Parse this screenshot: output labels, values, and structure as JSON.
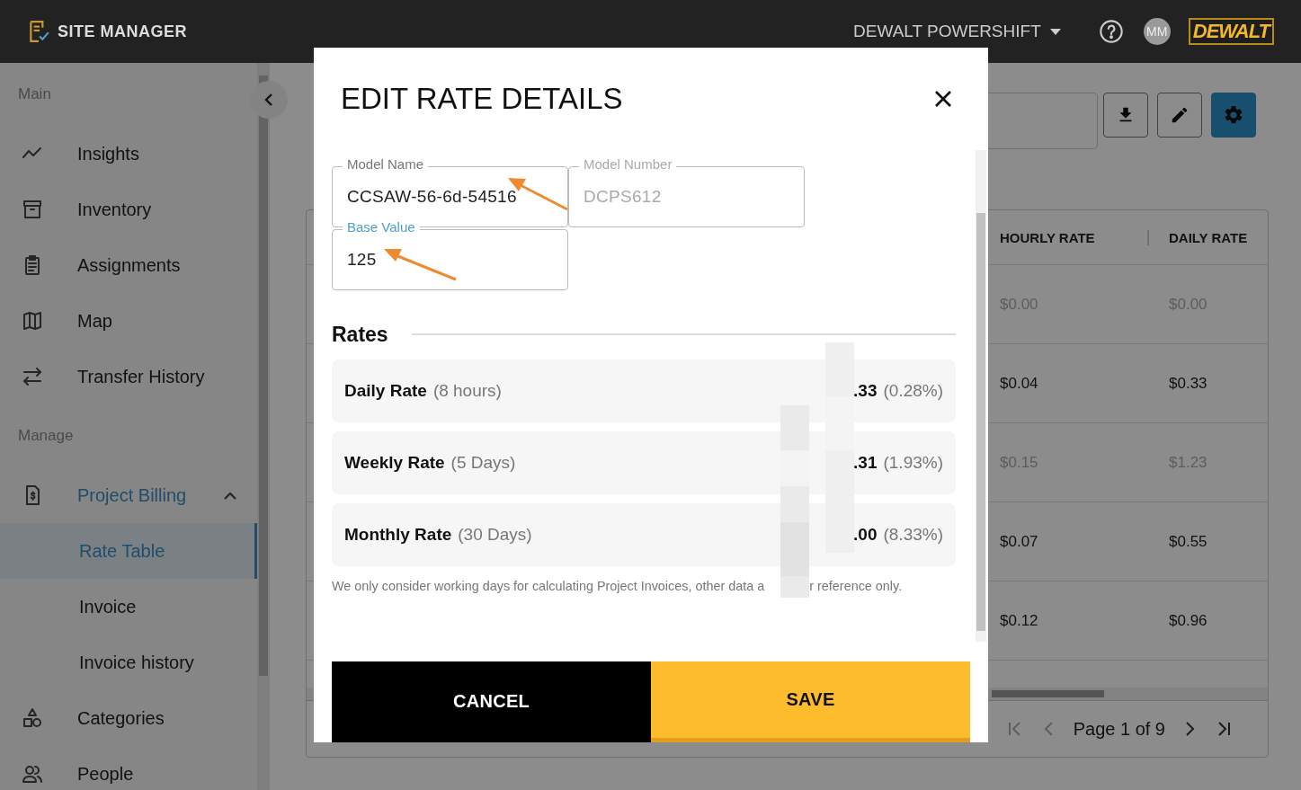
{
  "header": {
    "app_name": "SITE MANAGER",
    "account": "DEWALT POWERSHIFT",
    "avatar": "MM",
    "brand": "DEWALT"
  },
  "sidebar": {
    "sections": [
      {
        "title": "Main",
        "items": [
          {
            "label": "Insights",
            "selected": false
          },
          {
            "label": "Inventory",
            "selected": false
          },
          {
            "label": "Assignments",
            "selected": false
          },
          {
            "label": "Map",
            "selected": false
          },
          {
            "label": "Transfer History",
            "selected": false
          }
        ]
      },
      {
        "title": "Manage",
        "items": [
          {
            "label": "Project Billing",
            "selected": true,
            "expanded": true,
            "children": [
              {
                "label": "Rate Table",
                "selected": true
              },
              {
                "label": "Invoice",
                "selected": false
              },
              {
                "label": "Invoice history",
                "selected": false
              }
            ]
          },
          {
            "label": "Categories",
            "selected": false
          },
          {
            "label": "People",
            "selected": false
          }
        ]
      }
    ]
  },
  "toolbar": {
    "buttons": [
      {
        "kind": "download",
        "active": false
      },
      {
        "kind": "edit",
        "active": false
      },
      {
        "kind": "settings",
        "active": true
      }
    ]
  },
  "table": {
    "columns": [
      "HOURLY RATE",
      "DAILY RATE"
    ],
    "rows": [
      {
        "cells": [
          "$0.00",
          "$0.00"
        ],
        "disabled": true
      },
      {
        "cells": [
          "$0.04",
          "$0.33"
        ],
        "disabled": false
      },
      {
        "cells": [
          "$0.15",
          "$1.23"
        ],
        "disabled": true
      },
      {
        "cells": [
          "$0.07",
          "$0.55"
        ],
        "disabled": false
      },
      {
        "cells": [
          "$0.12",
          "$0.96"
        ],
        "disabled": false
      }
    ],
    "pagination": "Page 1 of 9"
  },
  "modal": {
    "title": "EDIT RATE DETAILS",
    "fields": [
      {
        "label": "Model Name",
        "value": "CCSAW-56-6d-54516",
        "disabled": false,
        "focused": false
      },
      {
        "label": "Model Number",
        "value": "DCPS612",
        "disabled": true,
        "focused": false
      },
      {
        "label": "Base Value",
        "value": "125",
        "disabled": false,
        "focused": true
      }
    ],
    "rates_heading": "Rates",
    "rates": [
      {
        "name": "Daily Rate",
        "period": "(8 hours)",
        "amount": ".33",
        "percent": "(0.28%)"
      },
      {
        "name": "Weekly Rate",
        "period": "(5 Days)",
        "amount": ".31",
        "percent": "(1.93%)"
      },
      {
        "name": "Monthly Rate",
        "period": "(30 Days)",
        "amount": ".00",
        "percent": "(8.33%)"
      }
    ],
    "note_parts": [
      "We only consider working days for calculating Project Invoices, other data a",
      "r reference only."
    ],
    "buttons": [
      {
        "label": "CANCEL",
        "kind": "cancel"
      },
      {
        "label": "SAVE",
        "kind": "save"
      }
    ]
  }
}
